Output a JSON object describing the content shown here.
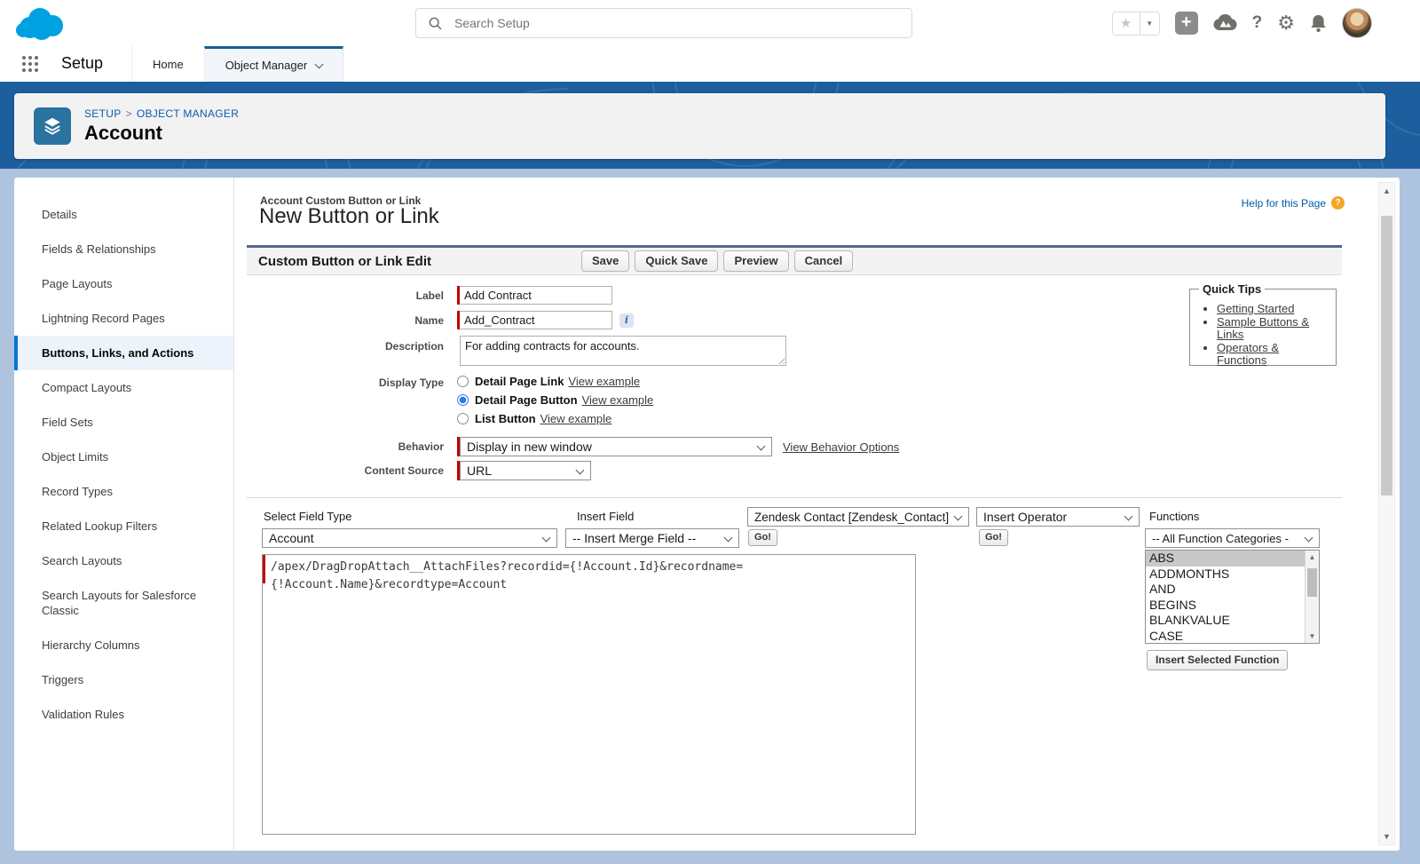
{
  "colors": {
    "brand_blue": "#00a1e0",
    "banner_blue": "#1d5f9e",
    "page_background": "#aec3de",
    "accent_link": "#0b5cab",
    "active_tab_border": "#10628e",
    "required_red": "#c00000",
    "sidebar_active_border": "#0176d3"
  },
  "glyphs": {
    "favorites_star": "★",
    "favorites_caret": "▼",
    "add_plus": "+",
    "help_question": "?",
    "gear": "⚙",
    "up_arrow": "▲",
    "down_arrow": "▼"
  },
  "global_header": {
    "search_placeholder": "Search Setup"
  },
  "nav": {
    "app_label": "Setup",
    "tabs": [
      {
        "label": "Home",
        "active": false
      },
      {
        "label": "Object Manager",
        "active": true
      }
    ]
  },
  "page_header": {
    "breadcrumb": [
      "SETUP",
      "OBJECT MANAGER"
    ],
    "separator": ">",
    "title": "Account"
  },
  "sidebar": {
    "items": [
      {
        "label": "Details",
        "active": false
      },
      {
        "label": "Fields & Relationships",
        "active": false
      },
      {
        "label": "Page Layouts",
        "active": false
      },
      {
        "label": "Lightning Record Pages",
        "active": false
      },
      {
        "label": "Buttons, Links, and Actions",
        "active": true
      },
      {
        "label": "Compact Layouts",
        "active": false
      },
      {
        "label": "Field Sets",
        "active": false
      },
      {
        "label": "Object Limits",
        "active": false
      },
      {
        "label": "Record Types",
        "active": false
      },
      {
        "label": "Related Lookup Filters",
        "active": false
      },
      {
        "label": "Search Layouts",
        "active": false
      },
      {
        "label": "Search Layouts for Salesforce Classic",
        "active": false
      },
      {
        "label": "Hierarchy Columns",
        "active": false
      },
      {
        "label": "Triggers",
        "active": false
      },
      {
        "label": "Validation Rules",
        "active": false
      }
    ]
  },
  "main": {
    "context_label": "Account Custom Button or Link",
    "page_title": "New Button or Link",
    "help_link": "Help for this Page",
    "section_title": "Custom Button or Link Edit",
    "toolbar": {
      "save_label": "Save",
      "quick_save_label": "Quick Save",
      "preview_label": "Preview",
      "cancel_label": "Cancel"
    },
    "form": {
      "label_field": {
        "label": "Label",
        "value": "Add Contract"
      },
      "name_field": {
        "label": "Name",
        "value": "Add_Contract",
        "info_icon": "i"
      },
      "description_field": {
        "label": "Description",
        "value": "For adding contracts for accounts."
      },
      "display_type": {
        "label": "Display Type",
        "options": [
          {
            "label": "Detail Page Link",
            "example_link": "View example",
            "selected": false
          },
          {
            "label": "Detail Page Button",
            "example_link": "View example",
            "selected": true
          },
          {
            "label": "List Button",
            "example_link": "View example",
            "selected": false
          }
        ]
      },
      "behavior": {
        "label": "Behavior",
        "value": "Display in new window",
        "options_link": "View Behavior Options"
      },
      "content_source": {
        "label": "Content Source",
        "value": "URL"
      }
    },
    "quick_tips": {
      "title": "Quick Tips",
      "links": [
        "Getting Started",
        "Sample Buttons & Links",
        "Operators & Functions"
      ]
    },
    "editor": {
      "select_field_type_label": "Select Field Type",
      "field_type_value": "Account",
      "insert_field_label": "Insert Field",
      "insert_field_value": "-- Insert Merge Field --",
      "insert_field_go": "Go!",
      "merge_object_value": "Zendesk Contact [Zendesk_Contact]",
      "insert_operator_value": "Insert Operator",
      "insert_operator_go": "Go!",
      "functions_label": "Functions",
      "function_category_value": "-- All Function Categories -",
      "function_items": [
        "ABS",
        "ADDMONTHS",
        "AND",
        "BEGINS",
        "BLANKVALUE",
        "CASE"
      ],
      "selected_function": "ABS",
      "insert_function_button": "Insert Selected Function",
      "code_value": "/apex/DragDropAttach__AttachFiles?recordid={!Account.Id}&recordname=\n{!Account.Name}&recordtype=Account"
    }
  }
}
